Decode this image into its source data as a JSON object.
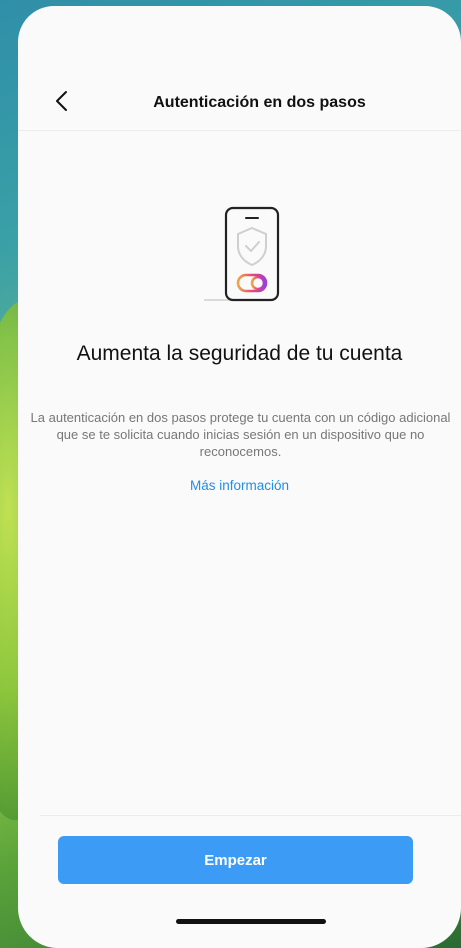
{
  "header": {
    "back_icon": "chevron-left-icon",
    "title": "Autenticación en dos pasos"
  },
  "illustration": {
    "icon": "phone-shield-icon",
    "accent_colors": [
      "#f3a447",
      "#e5467f",
      "#9b3fd8"
    ]
  },
  "main": {
    "headline": "Aumenta la seguridad de tu cuenta",
    "description": "La autenticación en dos pasos protege tu cuenta con un código adicional que se te solicita cuando inicias sesión en un dispositivo que no reconocemos.",
    "learn_more_link": "Más información"
  },
  "footer": {
    "start_button": "Empezar"
  },
  "colors": {
    "primary_button": "#3c9cf5",
    "link": "#1f8fe8",
    "background": "#fafafa"
  }
}
